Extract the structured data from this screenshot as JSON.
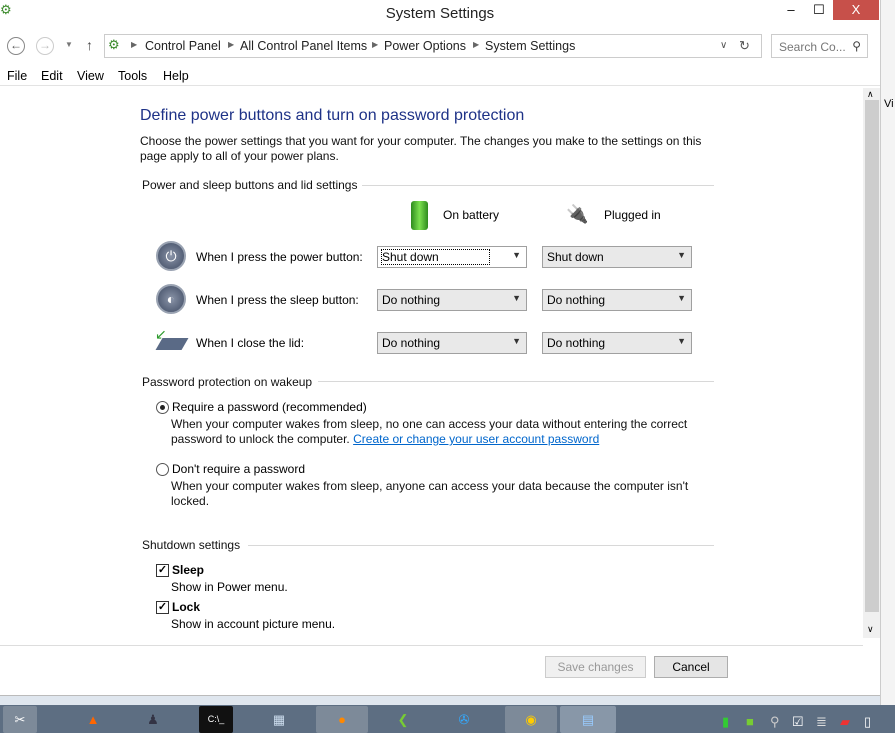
{
  "window": {
    "title": "System Settings",
    "minimize": "‒",
    "maximize": "☐",
    "close": "X"
  },
  "address": {
    "crumbs": [
      "Control Panel",
      "All Control Panel Items",
      "Power Options",
      "System Settings"
    ],
    "search_placeholder": "Search Co..."
  },
  "menu": [
    "File",
    "Edit",
    "View",
    "Tools",
    "Help"
  ],
  "page": {
    "heading": "Define power buttons and turn on password protection",
    "intro": "Choose the power settings that you want for your computer. The changes you make to the settings on this page apply to all of your power plans.",
    "power_group": "Power and sleep buttons and lid settings",
    "col_battery": "On battery",
    "col_plugged": "Plugged in",
    "rows": [
      {
        "label": "When I press the power button:",
        "battery": "Shut down",
        "plugged": "Shut down",
        "icon": "power-icon"
      },
      {
        "label": "When I press the sleep button:",
        "battery": "Do nothing",
        "plugged": "Do nothing",
        "icon": "sleep-icon"
      },
      {
        "label": "When I close the lid:",
        "battery": "Do nothing",
        "plugged": "Do nothing",
        "icon": "laptop-lid-icon"
      }
    ],
    "password_group": "Password protection on wakeup",
    "require_label": "Require a password (recommended)",
    "require_desc": "When your computer wakes from sleep, no one can access your data without entering the correct password to unlock the computer.",
    "require_link": "Create or change your user account password",
    "norequire_label": "Don't require a password",
    "norequire_desc": "When your computer wakes from sleep, anyone can access your data because the computer isn't locked.",
    "password_selected": "require",
    "shutdown_group": "Shutdown settings",
    "sleep_label": "Sleep",
    "sleep_desc": "Show in Power menu.",
    "sleep_checked": true,
    "lock_label": "Lock",
    "lock_desc": "Show in account picture menu.",
    "lock_checked": true
  },
  "footer": {
    "save": "Save changes",
    "cancel": "Cancel"
  },
  "background_window_text": "Vi"
}
